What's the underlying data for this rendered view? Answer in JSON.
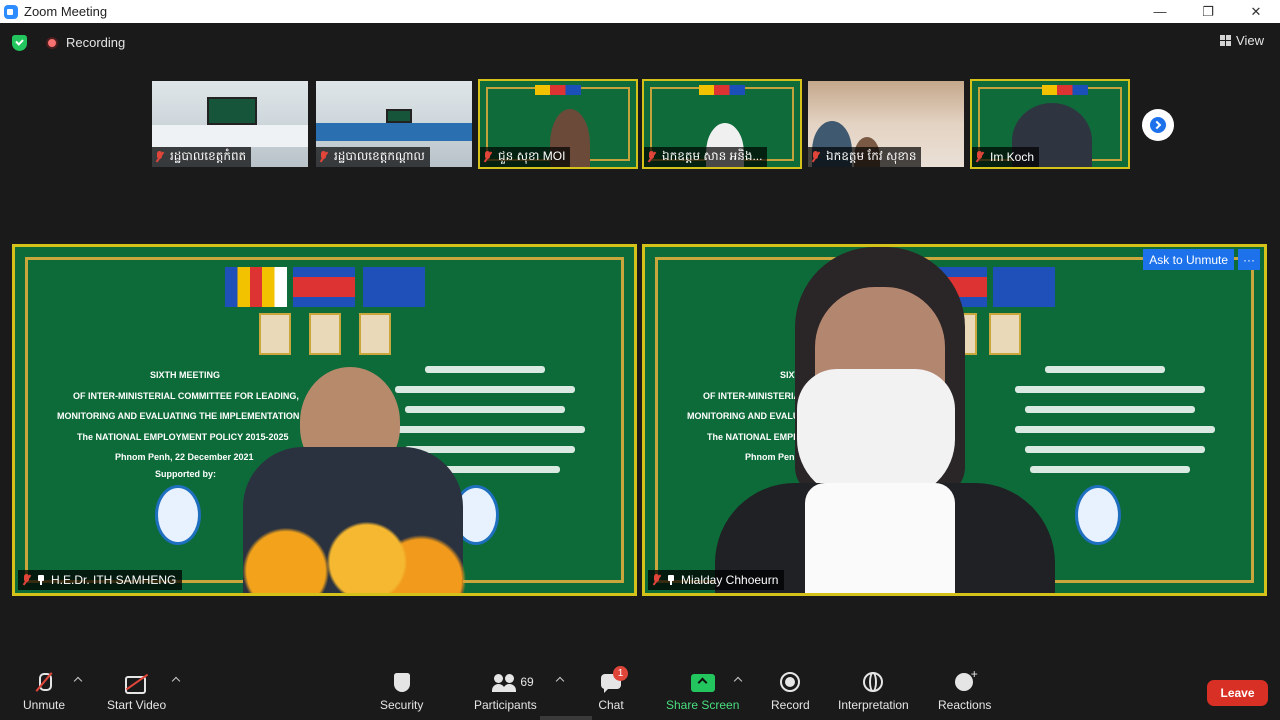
{
  "window": {
    "title": "Zoom Meeting",
    "controls": [
      "—",
      "❐",
      "✕"
    ]
  },
  "topbar": {
    "recording_label": "Recording",
    "view_label": "View"
  },
  "thumbnails": [
    {
      "name": "រដ្ឋបាលខេត្តកំពត",
      "speaking": false
    },
    {
      "name": "រដ្ឋបាលខេត្តកណ្ដាល",
      "speaking": false
    },
    {
      "name": "ជួន សុខា MOI",
      "speaking": true
    },
    {
      "name": "ឯកឧត្តម សាន អនិង...",
      "speaking": true
    },
    {
      "name": "ឯកឧត្តម កែវ សុខាន",
      "speaking": false
    },
    {
      "name": "Im Koch",
      "speaking": true
    }
  ],
  "stage": {
    "left": {
      "name": "H.E.Dr. ITH SAMHENG",
      "slide": {
        "title": "SIXTH MEETING",
        "line1": "OF INTER-MINISTERIAL COMMITTEE FOR LEADING,",
        "line2": "MONITORING AND EVALUATING THE IMPLEMENTATION",
        "line3": "The NATIONAL EMPLOYMENT POLICY 2015-2025",
        "date": "Phnom Penh, 22 December 2021",
        "supported": "Supported by:"
      }
    },
    "right": {
      "name": "Mialday Chhoeurn",
      "ask_unmute": "Ask to Unmute",
      "more": "···",
      "slide": {
        "title": "SIXTH MEETING",
        "line1": "OF INTER-MINISTERIAL",
        "line2": "MONITORING AND EVALUATI",
        "line3": "The NATIONAL EMPLOY",
        "date": "Phnom Penh, 22"
      }
    }
  },
  "toolbar": {
    "unmute": "Unmute",
    "start_video": "Start Video",
    "security": "Security",
    "participants": "Participants",
    "participants_count": "69",
    "chat": "Chat",
    "chat_badge": "1",
    "share_screen": "Share Screen",
    "record": "Record",
    "interpretation": "Interpretation",
    "reactions": "Reactions",
    "leave": "Leave"
  },
  "colors": {
    "active_speaker_border": "#d4c21a",
    "ask_unmute_bg": "#1d72ec",
    "leave_bg": "#d93025",
    "share_green": "#22c55e"
  }
}
